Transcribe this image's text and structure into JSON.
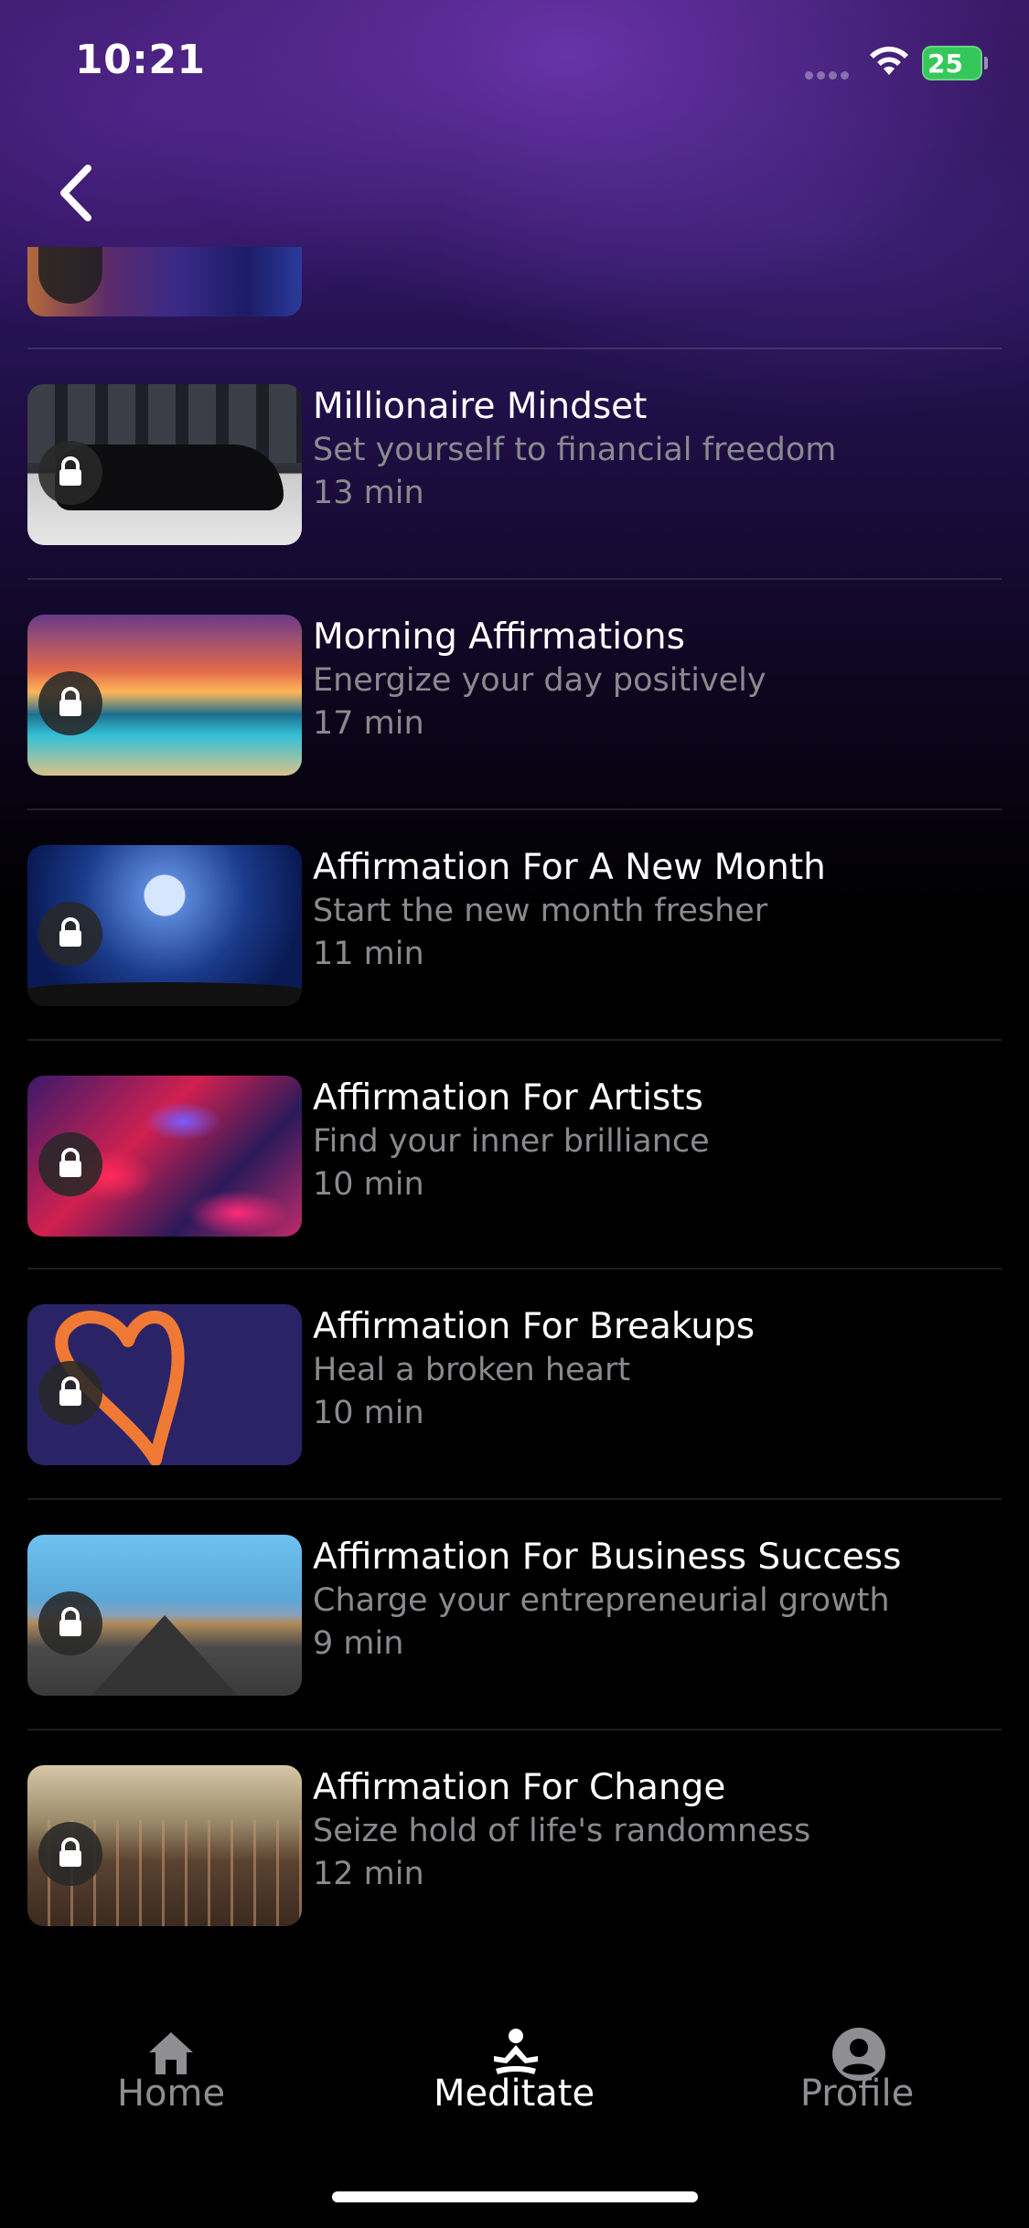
{
  "status_bar": {
    "time": "10:21",
    "battery": "25"
  },
  "nav": {
    "back_icon": "chevron-left-icon"
  },
  "items": [
    {
      "title": "Millionaire Mindset",
      "subtitle": "Set yourself to financial freedom",
      "duration": "13 min",
      "locked": true
    },
    {
      "title": "Morning Affirmations",
      "subtitle": "Energize your day positively",
      "duration": "17 min",
      "locked": true
    },
    {
      "title": "Affirmation For A New Month",
      "subtitle": "Start the new month fresher",
      "duration": "11 min",
      "locked": true
    },
    {
      "title": "Affirmation For Artists",
      "subtitle": "Find your inner brilliance",
      "duration": "10 min",
      "locked": true
    },
    {
      "title": "Affirmation For Breakups",
      "subtitle": "Heal a broken heart",
      "duration": "10 min",
      "locked": true
    },
    {
      "title": "Affirmation For Business Success",
      "subtitle": "Charge your entrepreneurial growth",
      "duration": "9 min",
      "locked": true
    },
    {
      "title": "Affirmation For Change",
      "subtitle": "Seize hold of life's randomness",
      "duration": "12 min",
      "locked": true
    }
  ],
  "tabbar": {
    "tabs": [
      {
        "label": "Home",
        "icon": "home-icon",
        "active": false
      },
      {
        "label": "Meditate",
        "icon": "meditate-icon",
        "active": true
      },
      {
        "label": "Profile",
        "icon": "profile-icon",
        "active": false
      }
    ]
  },
  "colors": {
    "accent_battery": "#34c759",
    "secondary_text": "#8a8a8e",
    "background": "#000000"
  }
}
